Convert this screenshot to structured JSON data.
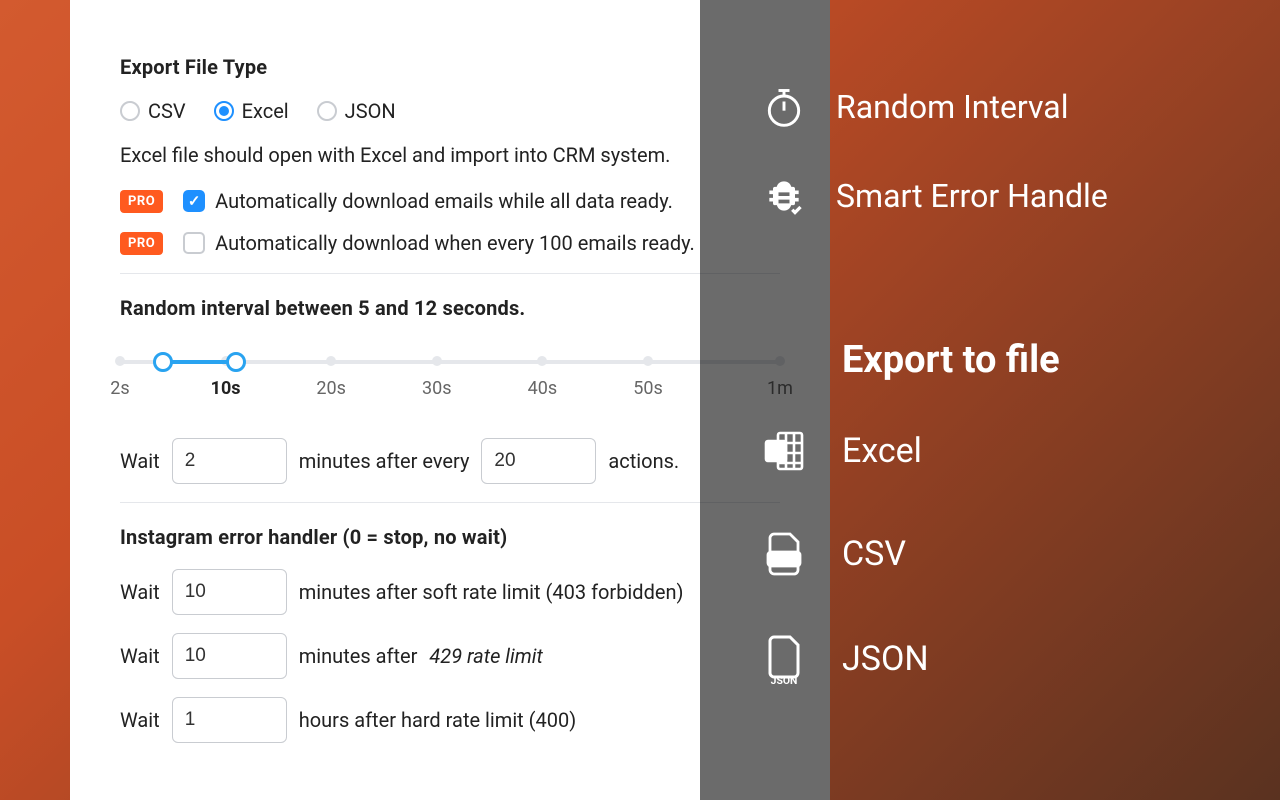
{
  "export": {
    "title": "Export File Type",
    "options": {
      "csv": "CSV",
      "excel": "Excel",
      "json": "JSON"
    },
    "selected": "excel",
    "hint": "Excel file should open with Excel and import into CRM system.",
    "pro_label": "PRO",
    "auto1": "Automatically download emails while all data ready.",
    "auto2": "Automatically download when every 100 emails ready."
  },
  "interval": {
    "title": "Random interval between 5 and 12 seconds.",
    "ticks": [
      "2s",
      "10s",
      "20s",
      "30s",
      "40s",
      "50s",
      "1m"
    ],
    "wait_label": "Wait",
    "minutes_label": "minutes after every",
    "actions_label": "actions.",
    "wait_minutes": "2",
    "every_actions": "20"
  },
  "errhandler": {
    "title": "Instagram error handler (0 = stop, no wait)",
    "soft_val": "10",
    "soft_label": "minutes after soft rate limit (403 forbidden)",
    "rate_val": "10",
    "rate_label1": "minutes after",
    "rate_label2": "429 rate limit",
    "hard_val": "1",
    "hard_label": "hours after hard rate limit (400)"
  },
  "sidebar": {
    "random": "Random Interval",
    "smart": "Smart Error Handle",
    "export_heading": "Export to file",
    "excel": "Excel",
    "csv": "CSV",
    "json": "JSON"
  }
}
